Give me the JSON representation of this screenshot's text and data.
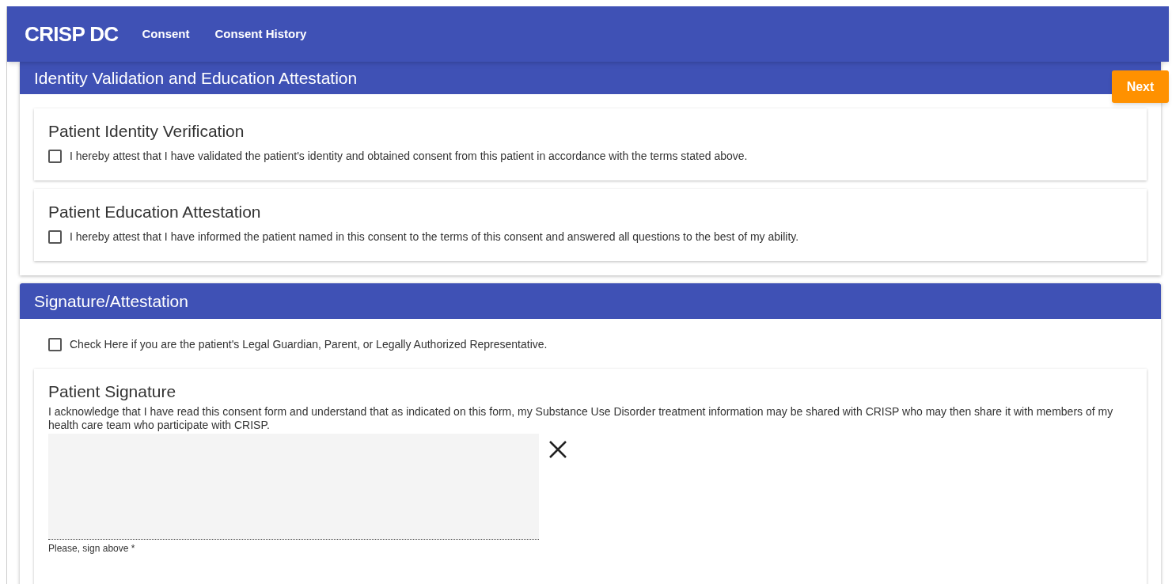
{
  "header": {
    "logo": {
      "word": "CRISP",
      "mark": "DC"
    },
    "nav": [
      {
        "label": "Consent"
      },
      {
        "label": "Consent History"
      }
    ]
  },
  "identity_section": {
    "title": "Identity Validation and Education Attestation",
    "next_button": "Next",
    "cards": [
      {
        "title": "Patient Identity Verification",
        "checkbox": {
          "label": "I hereby attest that I have validated the patient's identity and obtained consent from this patient in accordance with the terms stated above.",
          "checked": false
        }
      },
      {
        "title": "Patient Education Attestation",
        "checkbox": {
          "label": "I hereby attest that I have informed the patient named in this consent to the terms of this consent and answered all questions to the best of my ability.",
          "checked": false
        }
      }
    ]
  },
  "signature_section": {
    "title": "Signature/Attestation",
    "guardian_checkbox": {
      "label": "Check Here if you are the patient's Legal Guardian, Parent, or Legally Authorized Representative.",
      "checked": false
    },
    "signature_card": {
      "title": "Patient Signature",
      "text": "I acknowledge that I have read this consent form and understand that as indicated on this form, my Substance Use Disorder treatment information may be shared with CRISP who may then share it with members of my health care team who participate with CRISP.",
      "hint": "Please, sign above *"
    }
  }
}
